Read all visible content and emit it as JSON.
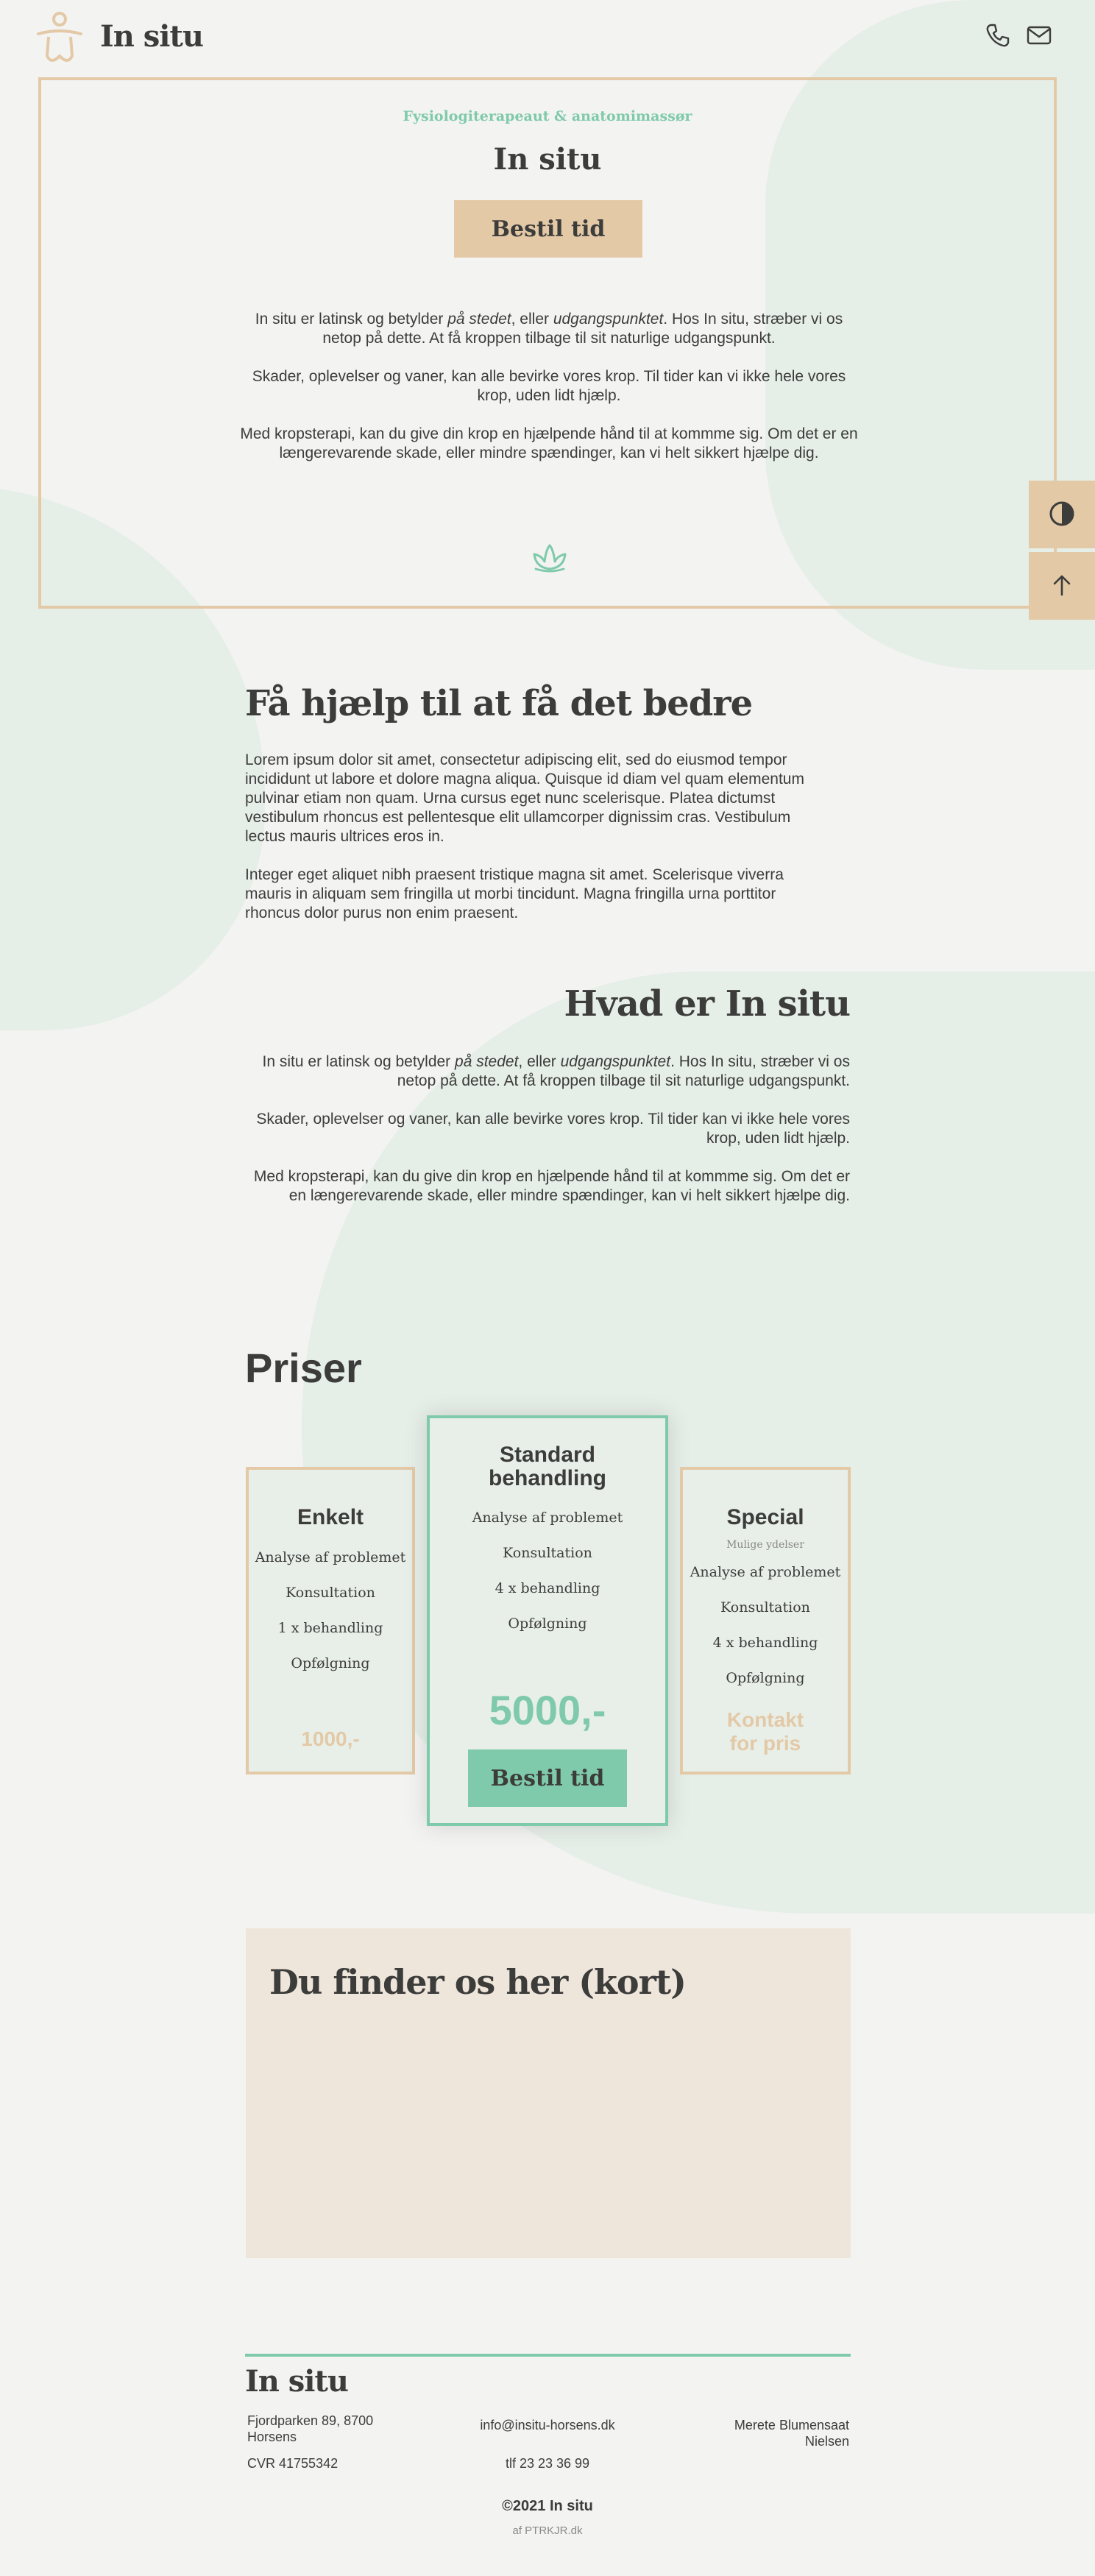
{
  "header": {
    "brand": "In situ",
    "icons": [
      "person-logo-icon",
      "phone-icon",
      "mail-icon"
    ]
  },
  "hero": {
    "eyebrow": "Fysiologiterapeaut & anatomimassør",
    "title": "In situ",
    "cta": "Bestil tid",
    "p1_a": "In situ er latinsk og betylder ",
    "p1_em1": "på stedet",
    "p1_b": ", eller ",
    "p1_em2": "udgangspunktet",
    "p1_c": ". Hos In situ, stræber vi os netop på dette. At få kroppen tilbage til sit naturlige udgangspunkt.",
    "p2": "Skader, oplevelser og vaner, kan alle bevirke vores krop. Til tider kan vi ikke hele vores krop, uden lidt hjælp.",
    "p3": "Med kropsterapi, kan du give din krop en hjælpende hånd til at kommme sig. Om det er en længerevarende skade, eller mindre spændinger, kan vi helt sikkert hjælpe dig."
  },
  "side": {
    "icons": [
      "contrast-toggle-icon",
      "arrow-up-icon"
    ]
  },
  "help": {
    "title": "Få hjælp til at få det bedre",
    "p1": "Lorem ipsum dolor sit amet, consectetur adipiscing elit, sed do eiusmod tempor incididunt ut labore et dolore magna aliqua. Quisque id diam vel quam elementum pulvinar etiam non quam. Urna cursus eget nunc scelerisque. Platea dictumst vestibulum rhoncus est pellentesque elit ullamcorper dignissim cras. Vestibulum lectus mauris ultrices eros in.",
    "p2": "Integer eget aliquet nibh praesent tristique magna sit amet. Scelerisque viverra mauris in aliquam sem fringilla ut morbi tincidunt. Magna fringilla urna porttitor rhoncus dolor purus non enim praesent."
  },
  "about": {
    "title": "Hvad er In situ",
    "p1_a": "In situ er latinsk og betylder ",
    "p1_em1": "på stedet",
    "p1_b": ", eller ",
    "p1_em2": "udgangspunktet",
    "p1_c": ". Hos In situ, stræber vi os netop på dette. At få kroppen tilbage til sit naturlige udgangspunkt.",
    "p2": "Skader, oplevelser og vaner, kan alle bevirke vores krop. Til tider kan vi ikke hele vores krop, uden lidt hjælp.",
    "p3": "Med kropsterapi, kan du give din krop en hjælpende hånd til at kommme sig. Om det er en længerevarende skade, eller mindre spændinger, kan vi helt sikkert hjælpe dig."
  },
  "prices": {
    "title": "Priser",
    "enkelt": {
      "title": "Enkelt",
      "features": [
        "Analyse af problemet",
        "Konsultation",
        "1 x behandling",
        "Opfølgning"
      ],
      "price": "1000,-"
    },
    "standard": {
      "title": "Standard behandling",
      "features": [
        "Analyse af problemet",
        "Konsultation",
        "4 x behandling",
        "Opfølgning"
      ],
      "price": "5000,-",
      "cta": "Bestil tid"
    },
    "special": {
      "title": "Special",
      "note": "Mulige ydelser",
      "features": [
        "Analyse af problemet",
        "Konsultation",
        "4 x behandling",
        "Opfølgning"
      ],
      "price": "Kontakt for pris"
    }
  },
  "map": {
    "title": "Du finder os her (kort)"
  },
  "footer": {
    "brand": "In situ",
    "address": "Fjordparken 89, 8700 Horsens",
    "cvr": "CVR 41755342",
    "email": "info@insitu-horsens.dk",
    "phone": "tlf 23 23 36 99",
    "person": "Merete Blumensaat Nielsen",
    "copyright": "©2021 In situ",
    "credit": "af PTRKJR.dk"
  },
  "colors": {
    "beige": "#e3c9a6",
    "green": "#7fcaaa",
    "text": "#3c3c3b",
    "background": "#f3f3f2",
    "blob": "#e6eee8"
  }
}
